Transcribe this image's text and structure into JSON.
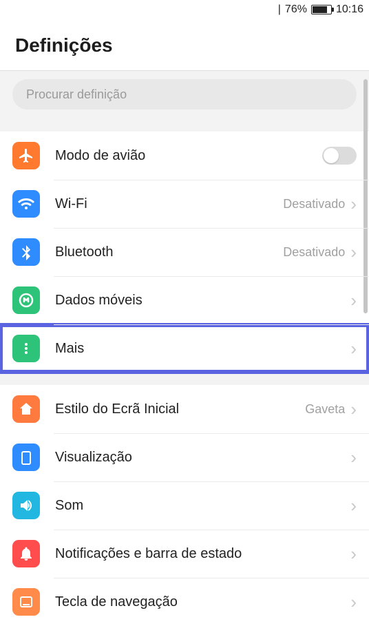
{
  "statusbar": {
    "battery_pct": "76%",
    "time": "10:16"
  },
  "title": "Definições",
  "search": {
    "placeholder": "Procurar definição"
  },
  "group1": {
    "airplane": {
      "label": "Modo de avião"
    },
    "wifi": {
      "label": "Wi-Fi",
      "value": "Desativado"
    },
    "bluetooth": {
      "label": "Bluetooth",
      "value": "Desativado"
    },
    "mobiledata": {
      "label": "Dados móveis"
    },
    "more": {
      "label": "Mais"
    }
  },
  "group2": {
    "homestyle": {
      "label": "Estilo do Ecrã Inicial",
      "value": "Gaveta"
    },
    "display": {
      "label": "Visualização"
    },
    "sound": {
      "label": "Som"
    },
    "notif": {
      "label": "Notificações e barra de estado"
    },
    "navkey": {
      "label": "Tecla de navegação"
    }
  }
}
